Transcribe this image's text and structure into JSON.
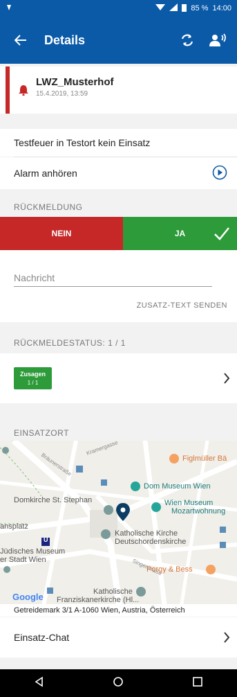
{
  "status_bar": {
    "battery": "85 %",
    "time": "14:00"
  },
  "app_bar": {
    "title": "Details",
    "icons": [
      "back-arrow-icon",
      "refresh-icon",
      "speaker-person-icon"
    ]
  },
  "alarm": {
    "name": "LWZ_Musterhof",
    "datetime": "15.4.2019, 13:59",
    "icon": "bell-icon"
  },
  "alarm_text": "Testfeuer in Testort kein Einsatz",
  "listen": {
    "label": "Alarm anhören",
    "icon": "play-circle-icon"
  },
  "response": {
    "section_label": "RÜCKMELDUNG",
    "no_label": "NEIN",
    "yes_label": "JA",
    "selected": "JA",
    "colors": {
      "no": "#c62828",
      "yes": "#2e9b3a"
    }
  },
  "message": {
    "placeholder": "Nachricht",
    "value": "",
    "send_label": "ZUSATZ-TEXT SENDEN"
  },
  "feedback_status": {
    "section_label": "RÜCKMELDESTATUS: 1 / 1",
    "badge_title": "Zusagen",
    "badge_count": "1 / 1"
  },
  "location": {
    "section_label": "EINSATZORT",
    "map_labels": {
      "figlmueller": "Figlmüller Bä",
      "dom_museum": "Dom Museum Wien",
      "domkirche": "Domkirche St. Stephan",
      "wien_museum_1": "Wien Museum",
      "wien_museum_2": "Mozartwohnung",
      "platz": "ansplatz",
      "kath_kirche_1": "Katholische Kirche",
      "kath_kirche_2": "Deutschordenskirche",
      "jued_museum_1": "Jüdisches Museum",
      "jued_museum_2": "er Stadt Wien",
      "porgy": "Porgy & Bess",
      "kath_bottom_1": "Katholische",
      "kath_bottom_2": "Franziskanerkirche (Hl...",
      "street_1": "Bräunerstraße",
      "street_2": "Kramergasse",
      "street_3": "Singerstraße",
      "subway": "U",
      "google": "Google"
    },
    "address": "Getreidemark 3/1 A-1060 Wien, Austria, Österreich"
  },
  "chat": {
    "label": "Einsatz-Chat"
  },
  "colors": {
    "primary": "#0a5aa8",
    "background": "#f2f2f2"
  }
}
